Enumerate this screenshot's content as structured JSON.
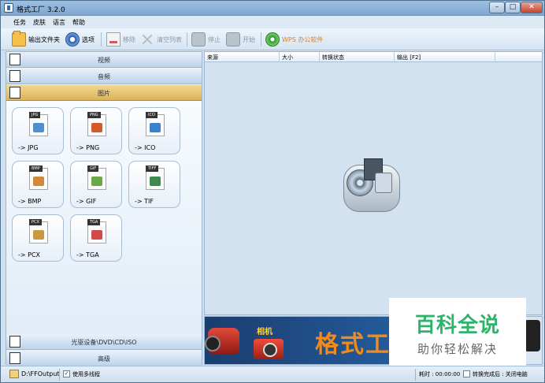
{
  "window": {
    "title": "格式工厂 3.2.0"
  },
  "menu": [
    "任务",
    "皮肤",
    "语言",
    "帮助"
  ],
  "toolbar": {
    "output_folder": "输出文件夹",
    "options": "选项",
    "remove": "移除",
    "clear_list": "清空列表",
    "stop": "停止",
    "start": "开始",
    "wps": "WPS 办公软件"
  },
  "categories": {
    "video": "视频",
    "audio": "音频",
    "picture": "图片",
    "optical": "光驱设备\\DVD\\CD\\ISO",
    "advanced": "高级"
  },
  "tiles": [
    {
      "tag": "JPG",
      "label": "-> JPG",
      "color": "#4f8fd0"
    },
    {
      "tag": "PNG",
      "label": "-> PNG",
      "color": "#d45a2a"
    },
    {
      "tag": "ICO",
      "label": "-> ICO",
      "color": "#3a7fd0"
    },
    {
      "tag": "BMP",
      "label": "-> BMP",
      "color": "#d08a3a"
    },
    {
      "tag": "GIF",
      "label": "-> GIF",
      "color": "#6aa848"
    },
    {
      "tag": "TIFF",
      "label": "-> TIF",
      "color": "#3d8a50"
    },
    {
      "tag": "PCX",
      "label": "-> PCX",
      "color": "#c89a40"
    },
    {
      "tag": "TGA",
      "label": "-> TGA",
      "color": "#d04a4a"
    }
  ],
  "list_columns": [
    "来源",
    "大小",
    "转换状态",
    "输出 [F2]"
  ],
  "banner": {
    "camera_label": "相机",
    "title": "格式工"
  },
  "watermark": {
    "top": "百科全说",
    "bottom": "助你轻松解决"
  },
  "status": {
    "output_path": "D:\\FFOutput",
    "multithread_check": "✓",
    "multithread_label": "使用多线程",
    "elapsed": "耗时 : 00:00:00",
    "after_convert": "转换完成后 : 关闭电脑"
  }
}
